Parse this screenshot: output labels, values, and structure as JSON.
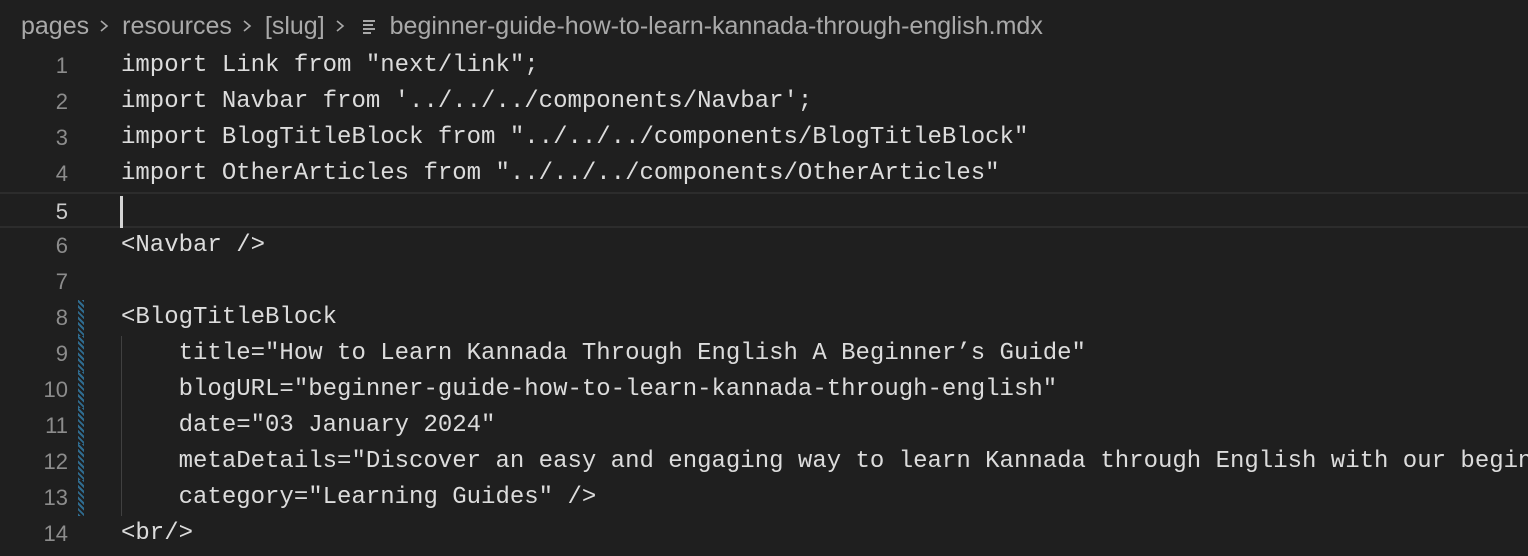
{
  "breadcrumb": {
    "items": [
      "pages",
      "resources",
      "[slug]"
    ],
    "file_name": "beginner-guide-how-to-learn-kannada-through-english.mdx"
  },
  "editor": {
    "current_line": 5,
    "lines": [
      {
        "number": "1",
        "text": "import Link from \"next/link\";"
      },
      {
        "number": "2",
        "text": "import Navbar from '../../../components/Navbar';"
      },
      {
        "number": "3",
        "text": "import BlogTitleBlock from \"../../../components/BlogTitleBlock\""
      },
      {
        "number": "4",
        "text": "import OtherArticles from \"../../../components/OtherArticles\""
      },
      {
        "number": "5",
        "text": ""
      },
      {
        "number": "6",
        "text": "<Navbar />"
      },
      {
        "number": "7",
        "text": ""
      },
      {
        "number": "8",
        "text": "<BlogTitleBlock"
      },
      {
        "number": "9",
        "text": "    title=\"How to Learn Kannada Through English A Beginner’s Guide\""
      },
      {
        "number": "10",
        "text": "    blogURL=\"beginner-guide-how-to-learn-kannada-through-english\""
      },
      {
        "number": "11",
        "text": "    date=\"03 January 2024\""
      },
      {
        "number": "12",
        "text": "    metaDetails=\"Discover an easy and engaging way to learn Kannada through English with our begin"
      },
      {
        "number": "13",
        "text": "    category=\"Learning Guides\" />"
      },
      {
        "number": "14",
        "text": "<br/>"
      }
    ]
  },
  "colors": {
    "background": "#1f1f1f",
    "text": "#dcdcdc",
    "line_number": "#8c8c8c",
    "modified_gutter": "#2f6c90"
  },
  "icons": {
    "separator": "chevron-right-icon",
    "file": "file-lines-icon"
  }
}
